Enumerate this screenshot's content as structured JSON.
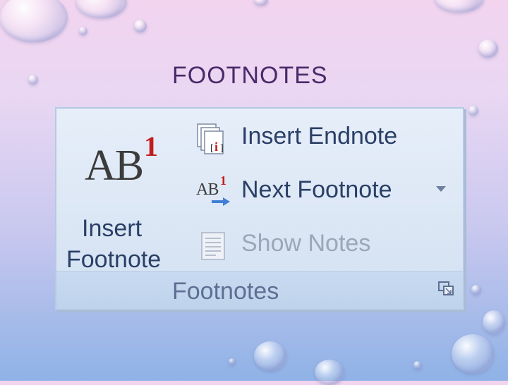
{
  "slide": {
    "title": "FOOTNOTES"
  },
  "ribbon": {
    "insert_footnote": {
      "label_line1": "Insert",
      "label_line2": "Footnote",
      "icon_text": "AB",
      "icon_sup": "1"
    },
    "insert_endnote": {
      "label": "Insert Endnote",
      "icon_text": "i"
    },
    "next_footnote": {
      "label": "Next Footnote",
      "icon_text": "AB",
      "icon_sup": "1"
    },
    "show_notes": {
      "label": "Show Notes",
      "disabled": true
    },
    "group_label": "Footnotes"
  },
  "colors": {
    "label": "#2a3f66",
    "disabled": "#9ba6b7",
    "accent_red": "#c21d1d",
    "title": "#4a2a6a"
  }
}
